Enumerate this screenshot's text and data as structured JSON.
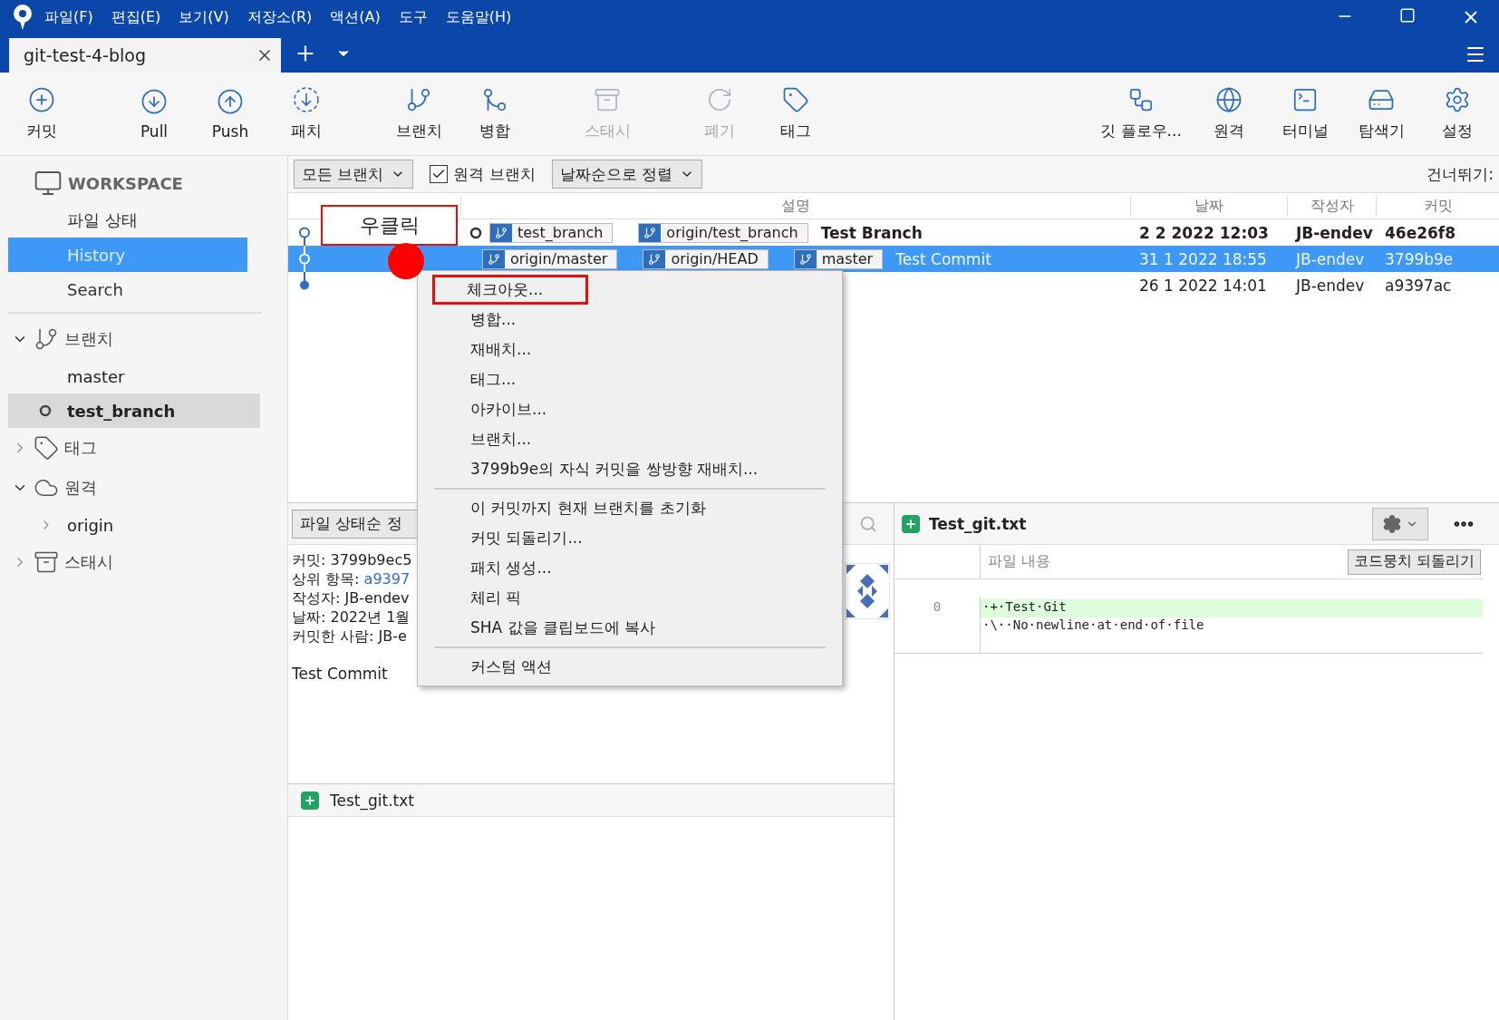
{
  "menu_bar": [
    "파일(F)",
    "편집(E)",
    "보기(V)",
    "저장소(R)",
    "액션(A)",
    "도구",
    "도움말(H)"
  ],
  "tab": {
    "label": "git-test-4-blog",
    "selected": true
  },
  "toolbar": {
    "left_groups": [
      [
        {
          "label": "커밋",
          "kind": "commit",
          "disabled": false
        }
      ],
      [
        {
          "label": "Pull",
          "kind": "pull",
          "disabled": false
        },
        {
          "label": "Push",
          "kind": "push",
          "disabled": false
        },
        {
          "label": "패치",
          "kind": "fetch",
          "disabled": false
        }
      ],
      [
        {
          "label": "브랜치",
          "kind": "branch",
          "disabled": false
        },
        {
          "label": "병합",
          "kind": "merge",
          "disabled": false
        }
      ],
      [
        {
          "label": "스태시",
          "kind": "stash",
          "disabled": true
        }
      ],
      [
        {
          "label": "폐기",
          "kind": "discard",
          "disabled": true
        },
        {
          "label": "태그",
          "kind": "tag",
          "disabled": false
        }
      ]
    ],
    "right": [
      {
        "label": "깃 플로우...",
        "kind": "gitflow",
        "disabled": false
      },
      {
        "label": "원격",
        "kind": "remote",
        "disabled": false
      },
      {
        "label": "터미널",
        "kind": "terminal",
        "disabled": false
      },
      {
        "label": "탐색기",
        "kind": "explorer",
        "disabled": false
      },
      {
        "label": "설정",
        "kind": "settings",
        "disabled": false
      }
    ]
  },
  "sidebar": {
    "workspace": {
      "title": "WORKSPACE",
      "items": [
        {
          "label": "파일 상태",
          "selected": false
        },
        {
          "label": "History",
          "selected": true
        },
        {
          "label": "Search",
          "selected": false
        }
      ]
    },
    "sections": [
      {
        "title": "브랜치",
        "kind": "branch",
        "expanded": true,
        "items": [
          {
            "label": "master",
            "current": false,
            "selected": false
          },
          {
            "label": "test_branch",
            "current": true,
            "selected": true
          }
        ]
      },
      {
        "title": "태그",
        "kind": "tag",
        "expanded": false
      },
      {
        "title": "원격",
        "kind": "remote",
        "expanded": true,
        "items": [
          {
            "label": "origin",
            "current": false,
            "selected": false,
            "collapsible": true
          }
        ]
      },
      {
        "title": "스태시",
        "kind": "stash",
        "expanded": false
      }
    ]
  },
  "filter_bar": {
    "branch_filter": "모든 브랜치",
    "remote_branches": {
      "label": "원격 브랜치",
      "checked": true
    },
    "sort": "날짜순으로 정렬",
    "jump": "건너뛰기:"
  },
  "commit_table": {
    "columns": [
      "설명",
      "날짜",
      "작성자",
      "커밋"
    ],
    "rows": [
      {
        "refs": [
          {
            "label": "test_branch",
            "current": true
          },
          {
            "label": "origin/test_branch",
            "current": false
          }
        ],
        "message": "Test Branch",
        "date": "2 2 2022 12:03",
        "author": "JB-endev",
        "hash": "46e26f8",
        "bold": true,
        "selected": false,
        "node_filled": false
      },
      {
        "refs": [
          {
            "label": "origin/master",
            "current": false
          },
          {
            "label": "origin/HEAD",
            "current": false
          },
          {
            "label": "master",
            "current": false
          }
        ],
        "message": "Test Commit",
        "date": "31 1 2022 18:55",
        "author": "JB-endev",
        "hash": "3799b9e",
        "bold": false,
        "selected": true,
        "node_filled": false
      },
      {
        "refs": [],
        "date": "26 1 2022 14:01",
        "author": "JB-endev",
        "hash": "a9397ac",
        "bold": false,
        "selected": false,
        "node_filled": true
      }
    ]
  },
  "annotation": {
    "label": "우클릭"
  },
  "context_menu": {
    "groups": [
      [
        {
          "label": "체크아웃...",
          "highlighted": true
        },
        {
          "label": "병합...",
          "highlighted": false
        },
        {
          "label": "재배치...",
          "highlighted": false
        },
        {
          "label": "태그...",
          "highlighted": false
        },
        {
          "label": "아카이브...",
          "highlighted": false
        },
        {
          "label": "브랜치...",
          "highlighted": false
        },
        {
          "label": "3799b9e의 자식 커밋을 쌍방향 재배치...",
          "highlighted": false
        }
      ],
      [
        {
          "label": "이 커밋까지 현재 브랜치를 초기화",
          "highlighted": false
        },
        {
          "label": "커밋 되돌리기...",
          "highlighted": false
        },
        {
          "label": "패치 생성...",
          "highlighted": false
        },
        {
          "label": "체리 픽",
          "highlighted": false
        },
        {
          "label": "SHA 값을 클립보드에 복사",
          "highlighted": false
        }
      ],
      [
        {
          "label": "커스텀 액션",
          "highlighted": false
        }
      ]
    ]
  },
  "commit_details": {
    "sort": "파일 상태순 정",
    "lines": [
      {
        "label": "커밋:",
        "value": "3799b9ec5",
        "link": false
      },
      {
        "label": "상위 항목:",
        "value": "a9397",
        "link": true
      },
      {
        "label": "작성자:",
        "value": "JB-endev",
        "link": false
      },
      {
        "label": "날짜:",
        "value": "2022년 1월",
        "link": false
      },
      {
        "label": "커밋한 사람:",
        "value": "JB-e",
        "link": false
      }
    ],
    "message": "Test Commit"
  },
  "file_list": [
    {
      "name": "Test_git.txt",
      "added": true
    }
  ],
  "diff": {
    "file": "Test_git.txt",
    "added": true,
    "header": "파일 내용",
    "discard_hunk": "코드뭉치 되돌리기",
    "lines": [
      {
        "number": "0",
        "text": "·+·Test·Git",
        "kind": "added"
      },
      {
        "text": "·\\··No·newline·at·end·of·file",
        "kind": "context"
      }
    ]
  }
}
